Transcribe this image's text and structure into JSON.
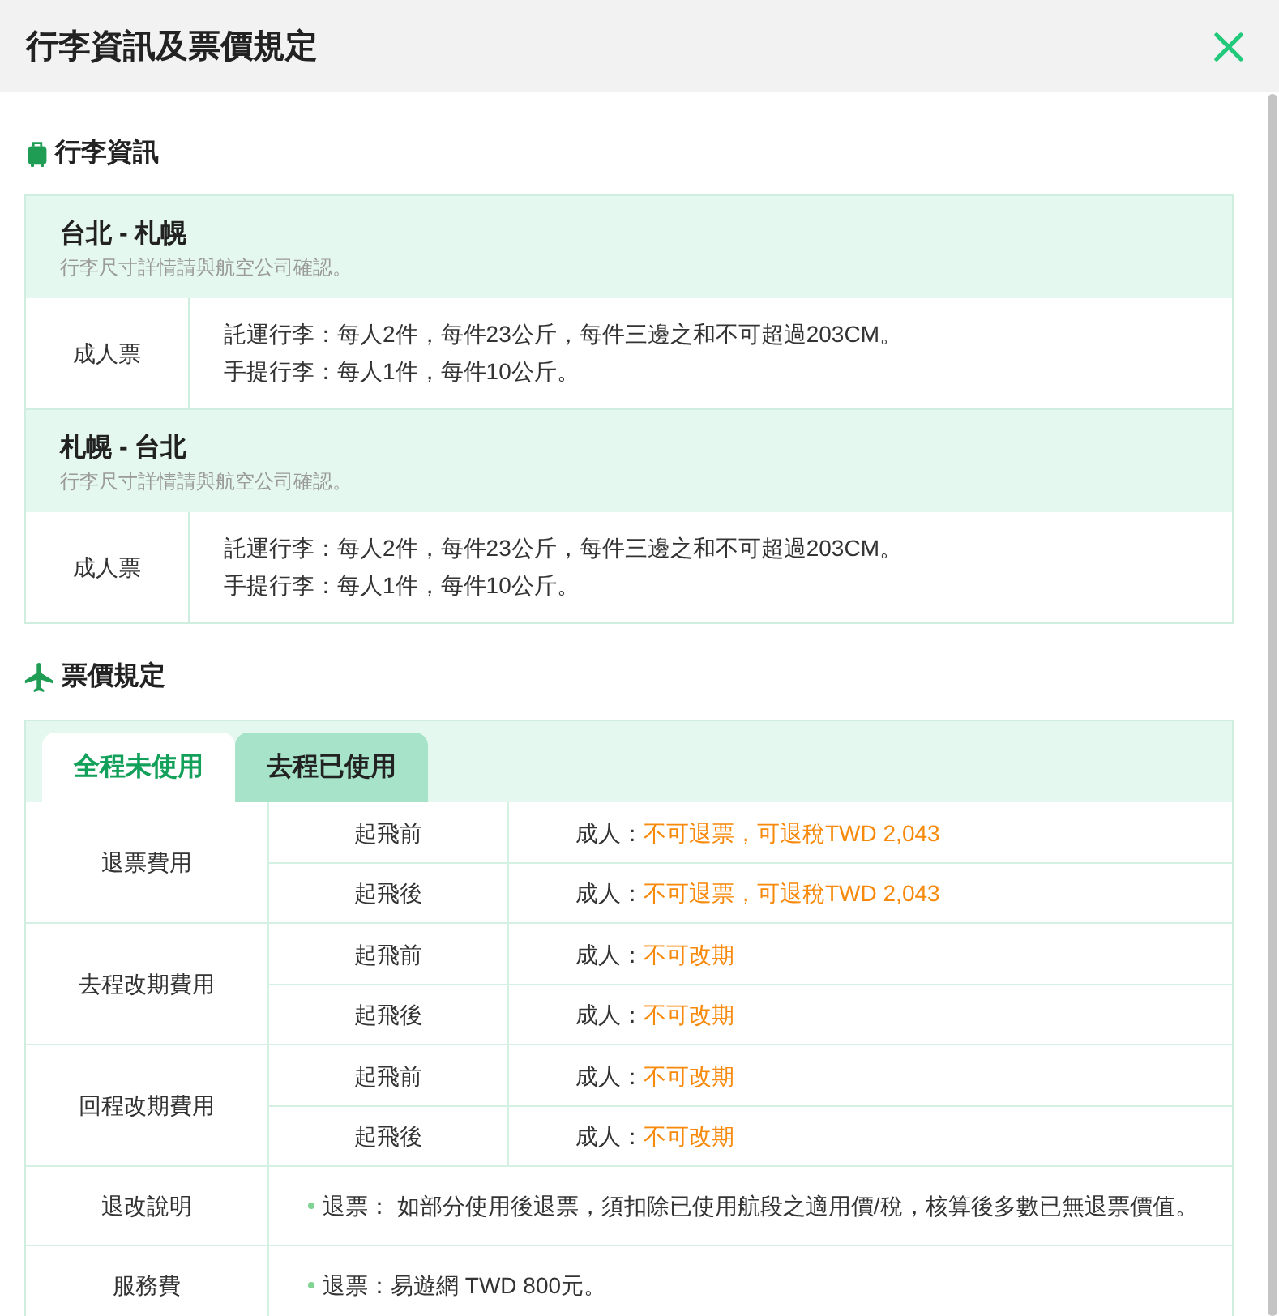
{
  "dialog": {
    "title": "行李資訊及票價規定"
  },
  "baggage": {
    "heading": "行李資訊",
    "segments": [
      {
        "route": "台北 - 札幌",
        "note": "行李尺寸詳情請與航空公司確認。",
        "rows": [
          {
            "passenger": "成人票",
            "lines": [
              "託運行李：每人2件，每件23公斤，每件三邊之和不可超過203CM。",
              "手提行李：每人1件，每件10公斤。"
            ]
          }
        ]
      },
      {
        "route": "札幌 - 台北",
        "note": "行李尺寸詳情請與航空公司確認。",
        "rows": [
          {
            "passenger": "成人票",
            "lines": [
              "託運行李：每人2件，每件23公斤，每件三邊之和不可超過203CM。",
              "手提行李：每人1件，每件10公斤。"
            ]
          }
        ]
      }
    ]
  },
  "fare_rules": {
    "heading": "票價規定",
    "tabs": [
      {
        "label": "全程未使用",
        "selected": true
      },
      {
        "label": "去程已使用",
        "selected": false
      }
    ],
    "rules": [
      {
        "kind": "timed",
        "label": "退票費用",
        "rows": [
          {
            "timing": "起飛前",
            "passenger": "成人：",
            "fee": "不可退票，可退稅TWD 2,043"
          },
          {
            "timing": "起飛後",
            "passenger": "成人：",
            "fee": "不可退票，可退稅TWD 2,043"
          }
        ]
      },
      {
        "kind": "timed",
        "label": "去程改期費用",
        "rows": [
          {
            "timing": "起飛前",
            "passenger": "成人：",
            "fee": "不可改期"
          },
          {
            "timing": "起飛後",
            "passenger": "成人：",
            "fee": "不可改期"
          }
        ]
      },
      {
        "kind": "timed",
        "label": "回程改期費用",
        "rows": [
          {
            "timing": "起飛前",
            "passenger": "成人：",
            "fee": "不可改期"
          },
          {
            "timing": "起飛後",
            "passenger": "成人：",
            "fee": "不可改期"
          }
        ]
      },
      {
        "kind": "note",
        "label": "退改說明",
        "items": [
          "退票： 如部分使用後退票，須扣除已使用航段之適用價/稅，核算後多數已無退票價值。"
        ]
      },
      {
        "kind": "note",
        "label": "服務費",
        "items": [
          "退票：易遊網 TWD 800元。"
        ]
      }
    ]
  }
}
